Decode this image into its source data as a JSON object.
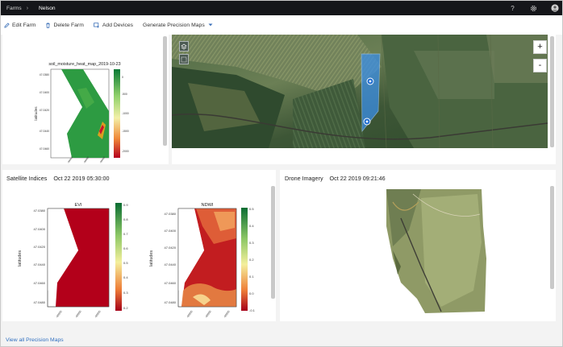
{
  "breadcrumb": {
    "farms": "Farms",
    "farm_name": "Nelson"
  },
  "toolbar": {
    "edit_farm": "Edit Farm",
    "delete_farm": "Delete Farm",
    "add_devices": "Add Devices",
    "generate_maps": "Generate Precision Maps"
  },
  "soil_map": {
    "title": "soil_moisture_heat_map_2019-10-23",
    "ylabel": "latitudes",
    "yticks": [
      "47.0380",
      "47.0400",
      "47.0420",
      "47.0440",
      "47.0460"
    ],
    "xticks": [
      "-99900",
      "-99950",
      "-99900"
    ],
    "colorbar_ticks": [
      "0",
      "-500",
      "-1000",
      "-1500",
      "-2000"
    ]
  },
  "satellite": {
    "title": "Satellite Indices",
    "timestamp": "Oct 22 2019 05:30:00",
    "evi": {
      "title": "EVI",
      "ylabel": "latitudes",
      "yticks": [
        "47.0380",
        "47.0400",
        "47.0420",
        "47.0440",
        "47.0460",
        "47.0480"
      ],
      "colorbar_ticks": [
        "0.9",
        "0.8",
        "0.7",
        "0.6",
        "0.5",
        "0.4",
        "0.3",
        "0.2"
      ],
      "xticks": [
        "-99900",
        "-99950",
        "-99900"
      ]
    },
    "ndwi": {
      "title": "NDWI",
      "ylabel": "latitudes",
      "yticks": [
        "47.0380",
        "47.0400",
        "47.0420",
        "47.0440",
        "47.0460",
        "47.0480"
      ],
      "colorbar_ticks": [
        "0.5",
        "0.4",
        "0.3",
        "0.2",
        "0.1",
        "0.0",
        "-0.1"
      ],
      "xticks": [
        "-99900",
        "-99950",
        "-99900"
      ]
    }
  },
  "drone": {
    "title": "Drone Imagery",
    "timestamp": "Oct 22 2019 09:21:46"
  },
  "map_controls": {
    "zoom_in": "+",
    "zoom_out": "-"
  },
  "footer": {
    "view_all": "View all Precision Maps"
  },
  "colors": {
    "topbar": "#15161a",
    "accent_blue": "#3a8ee6",
    "heat_green": "#1d8f3d",
    "heat_red": "#b0001c"
  }
}
